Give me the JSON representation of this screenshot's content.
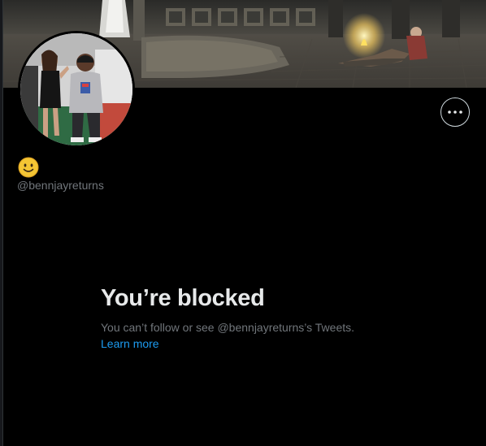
{
  "profile": {
    "display_name_emoji": "smiling-face-emoji",
    "handle": "@bennjayreturns"
  },
  "header": {
    "more_button_icon": "more-horizontal-icon"
  },
  "blocked": {
    "title": "You’re blocked",
    "description": "You can’t follow or see @bennjayreturns’s Tweets.",
    "learn_more": "Learn more"
  },
  "colors": {
    "background": "#000000",
    "primary_text": "#e7e9ea",
    "secondary_text": "#71767b",
    "link": "#1d9bf0",
    "button_border": "#cfd9de",
    "emoji_yellow": "#f4c534"
  }
}
